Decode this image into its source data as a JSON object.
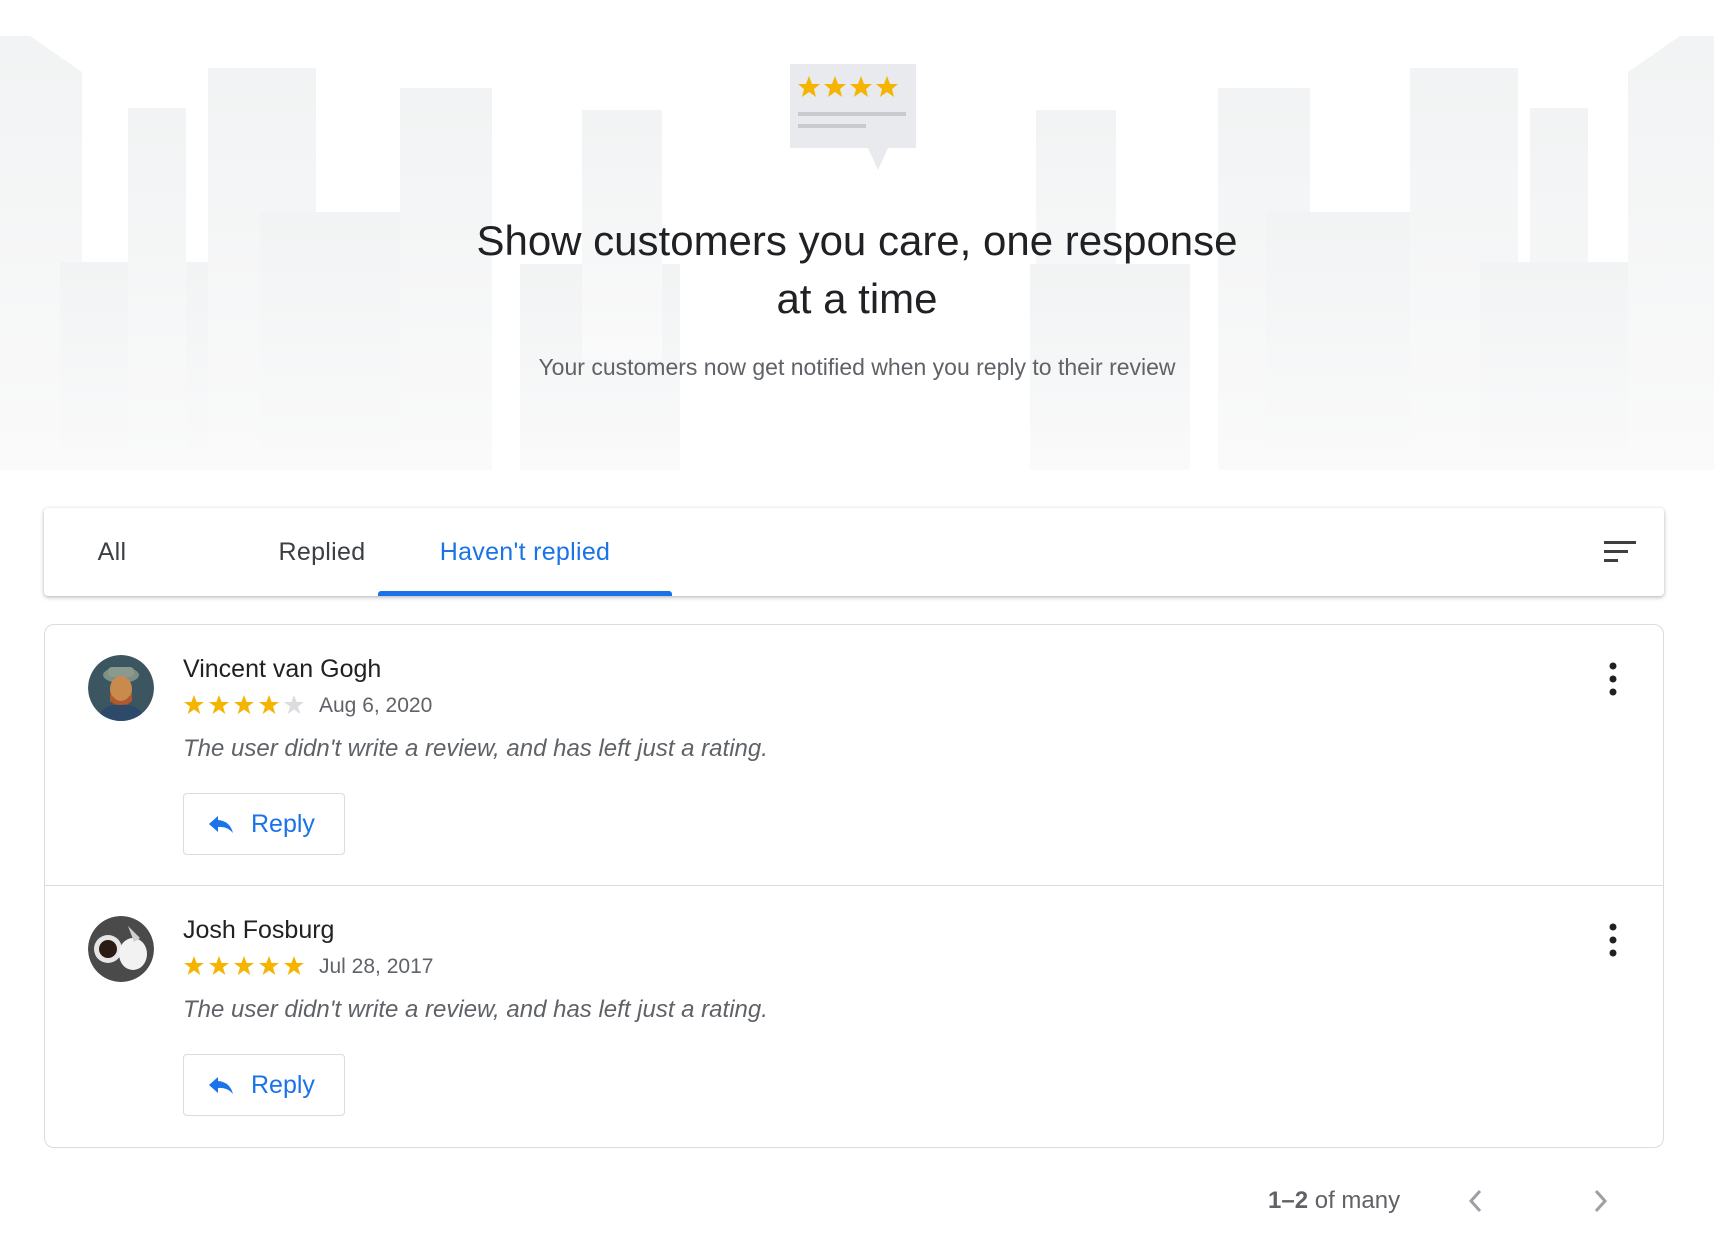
{
  "hero": {
    "illustration_icon": "review-bubble-stars-icon",
    "title": "Show customers you care, one response at a time",
    "subtitle": "Your customers now get notified when you reply to their review"
  },
  "tabs": [
    {
      "label": "All",
      "active": false
    },
    {
      "label": "Replied",
      "active": false
    },
    {
      "label": "Haven't replied",
      "active": true
    }
  ],
  "sort_icon": "sort-icon",
  "reviews": [
    {
      "name": "Vincent van Gogh",
      "rating": 4,
      "max_rating": 5,
      "date": "Aug 6, 2020",
      "text": "The user didn't write a review, and has left just a rating.",
      "reply_label": "Reply"
    },
    {
      "name": "Josh Fosburg",
      "rating": 5,
      "max_rating": 5,
      "date": "Jul 28, 2017",
      "text": "The user didn't write a review, and has left just a rating.",
      "reply_label": "Reply"
    }
  ],
  "pagination": {
    "range": "1–2",
    "suffix": " of many"
  },
  "colors": {
    "accent": "#1a73e8",
    "star_filled": "#f4b400",
    "star_empty": "#dadce0",
    "text_primary": "#202124",
    "text_secondary": "#5f6368",
    "border": "#dadce0"
  }
}
